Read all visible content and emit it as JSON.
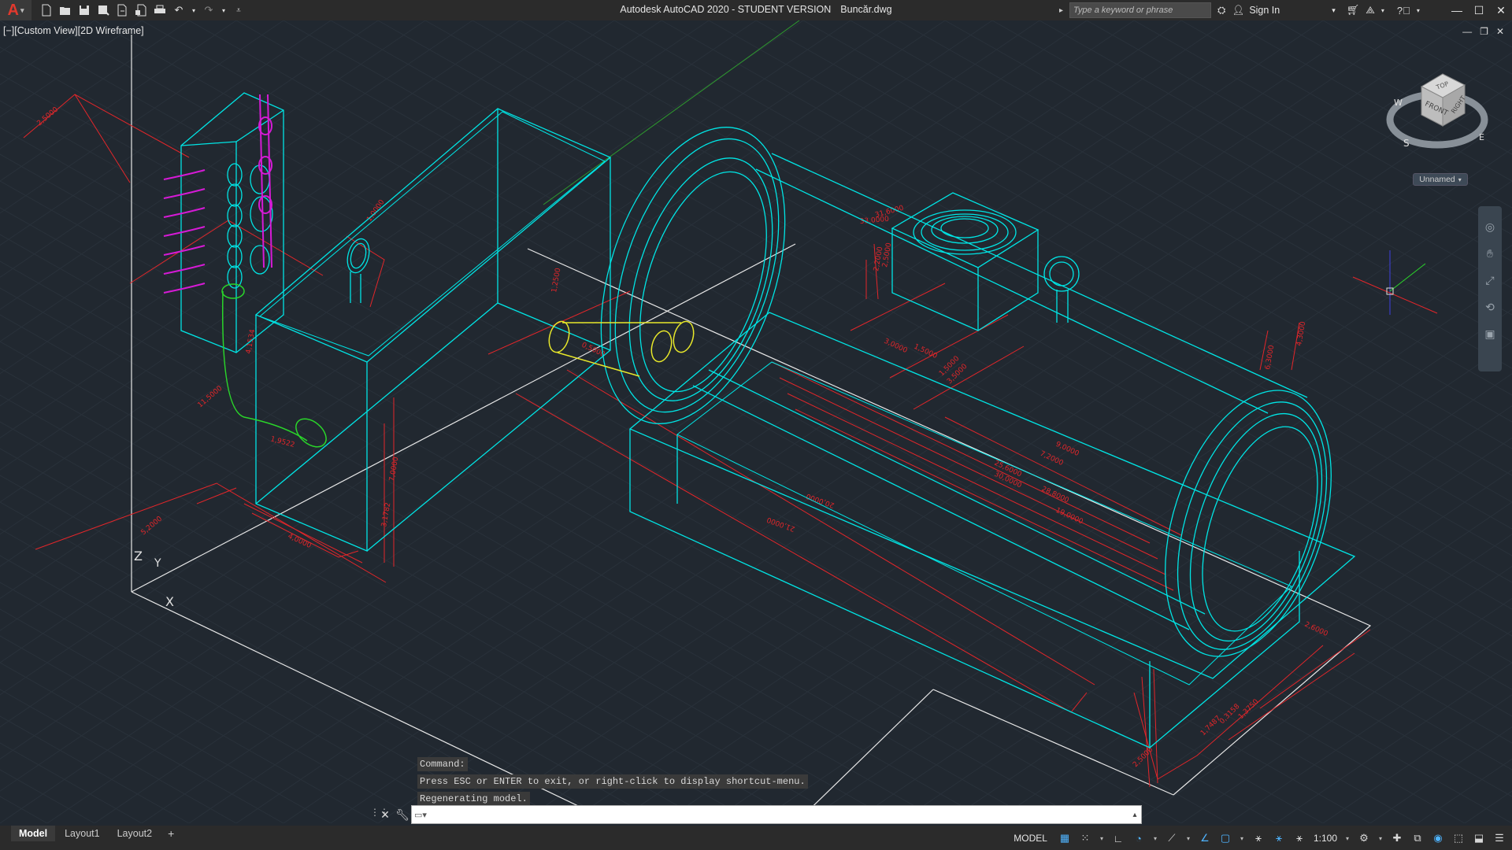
{
  "titlebar": {
    "app_name": "Autodesk AutoCAD 2020 - STUDENT VERSION",
    "file_name": "Buncăr.dwg",
    "search_placeholder": "Type a keyword or phrase",
    "sign_in": "Sign In",
    "app_letter": "A"
  },
  "quick_access": [
    "new-icon",
    "open-icon",
    "save-icon",
    "save-as-icon",
    "open-from-web-icon",
    "save-to-web-icon",
    "plot-icon",
    "undo-icon",
    "redo-icon",
    "customize-icon"
  ],
  "viewport": {
    "label": "[−][Custom View][2D Wireframe]"
  },
  "viewcube": {
    "top": "TOP",
    "front": "FRONT",
    "right": "RIGHT",
    "compass_w": "W",
    "compass_s": "S",
    "compass_e": "E",
    "ucs_name": "Unnamed"
  },
  "drawing": {
    "ucs_z": "Z",
    "ucs_y": "Y",
    "ucs_x": "X",
    "dims": [
      "2,5000",
      "4,1534",
      "11,5000",
      "1,9522",
      "5,2000",
      "4,0000",
      "3,1782",
      "7,0000",
      "1,0000",
      "21,0000",
      "20,0000",
      "31,6000",
      "33,0000",
      "2,2000",
      "2,5000",
      "3,0000",
      "1,5000",
      "1,5000",
      "3,5000",
      "9,0000",
      "7,2000",
      "25,6000",
      "28,8000",
      "30,0000",
      "19,0000",
      "2,6000",
      "2,5000",
      "1,7487",
      "0,3158",
      "1,3750",
      "6,3000",
      "4,3000",
      "1,2500",
      "0,5000"
    ],
    "colors": {
      "background": "#212830",
      "grid": "#2a323b",
      "geometry": "#00e5e5",
      "dimensions": "#e3262a",
      "pipes": "#d61ad6",
      "highlight": "#e8e82a",
      "path": "#2ad62a",
      "axes": "#e0e0e0"
    }
  },
  "command": {
    "history": [
      "Command:",
      "Press ESC or ENTER to exit, or right-click to display shortcut-menu.",
      "Regenerating model."
    ],
    "input_value": ""
  },
  "layout_tabs": [
    "Model",
    "Layout1",
    "Layout2"
  ],
  "statusbar": {
    "model_label": "MODEL",
    "scale": "1:100"
  }
}
